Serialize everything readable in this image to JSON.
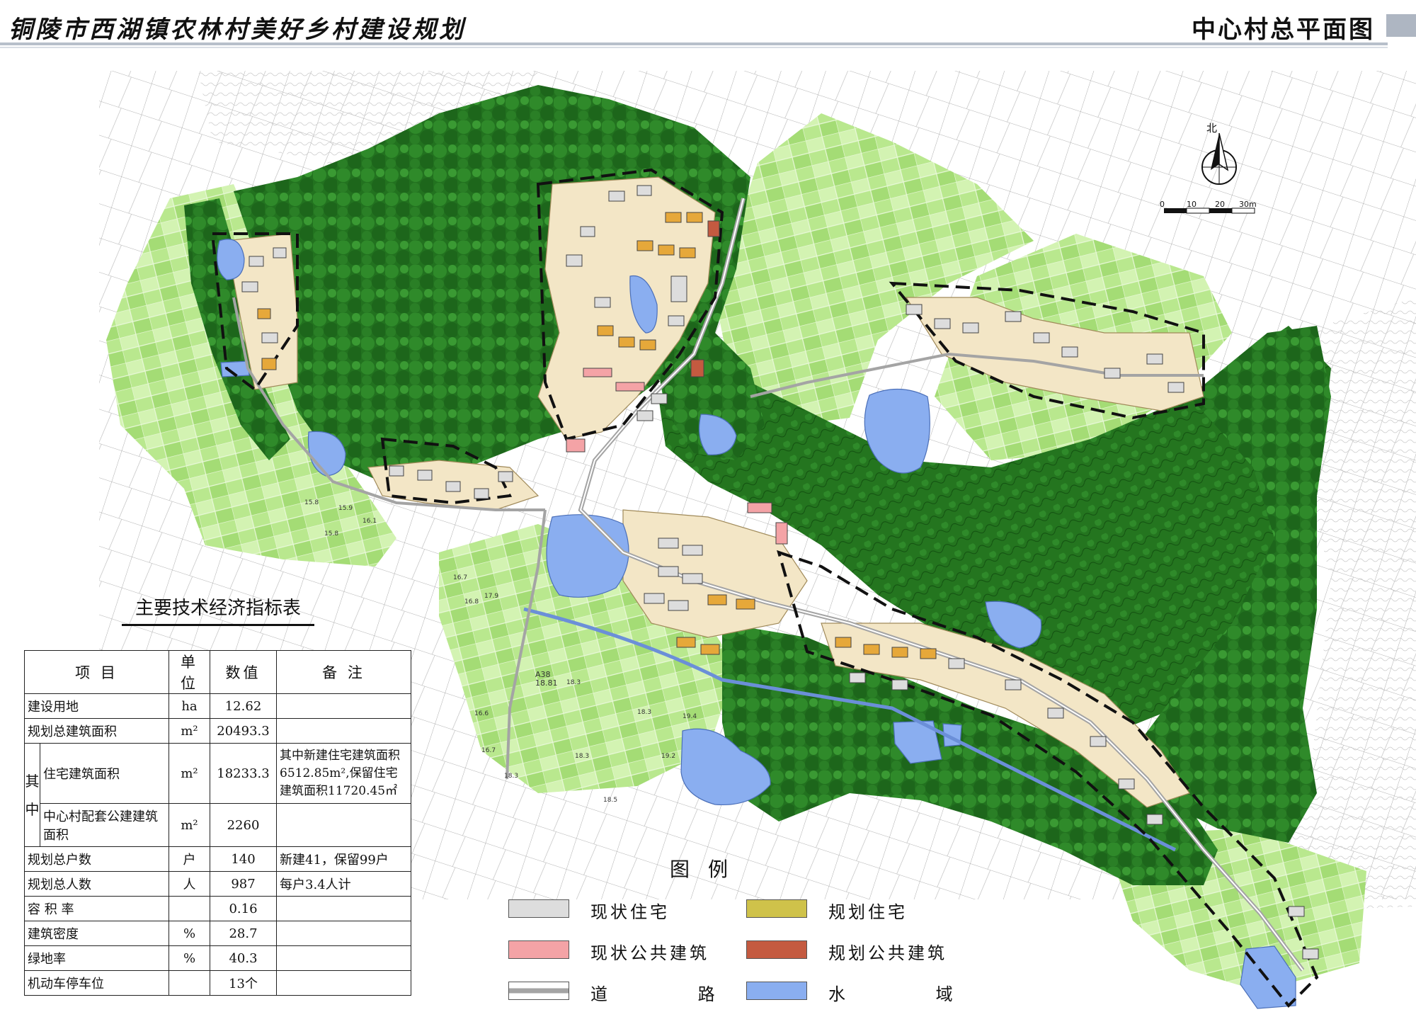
{
  "header": {
    "title": "铜陵市西湖镇农林村美好乡村建设规划",
    "right_title": "中心村总平面图"
  },
  "compass": {
    "north_label": "北"
  },
  "scale_bar": {
    "ticks": [
      "0",
      "10",
      "20",
      "30m"
    ]
  },
  "map_labels": {
    "spot_heights": [
      "15.8",
      "15.9",
      "16.1",
      "15.8",
      "16.7",
      "16.8",
      "17.9",
      "16.6",
      "18.3",
      "18.3",
      "19.4",
      "19.2",
      "18.3",
      "18.5",
      "16.7",
      "18.3"
    ],
    "road_code": "A38",
    "road_code_value": "18.81"
  },
  "tech_table": {
    "title": "主要技术经济指标表",
    "headers": [
      "项 目",
      "单位",
      "数值",
      "备 注"
    ],
    "group_label_top": "其",
    "group_label_bottom": "中",
    "rows": [
      {
        "item": "建设用地",
        "unit": "ha",
        "value": "12.62",
        "note": ""
      },
      {
        "item": "规划总建筑面积",
        "unit": "m²",
        "value": "20493.3",
        "note": ""
      },
      {
        "item": "住宅建筑面积",
        "unit": "m²",
        "value": "18233.3",
        "note": "其中新建住宅建筑面积6512.85m²,保留住宅建筑面积11720.45㎡"
      },
      {
        "item": "中心村配套公建建筑面积",
        "unit": "m²",
        "value": "2260",
        "note": ""
      },
      {
        "item": "规划总户数",
        "unit": "户",
        "value": "140",
        "note": "新建41，保留99户"
      },
      {
        "item": "规划总人数",
        "unit": "人",
        "value": "987",
        "note": "每户3.4人计"
      },
      {
        "item": "容 积 率",
        "unit": "",
        "value": "0.16",
        "note": ""
      },
      {
        "item": "建筑密度",
        "unit": "%",
        "value": "28.7",
        "note": ""
      },
      {
        "item": "绿地率",
        "unit": "%",
        "value": "40.3",
        "note": ""
      },
      {
        "item": "机动车停车位",
        "unit": "",
        "value": "13个",
        "note": ""
      }
    ]
  },
  "legend": {
    "title": "图例",
    "items": [
      {
        "label": "现状住宅",
        "color": "#dddddd",
        "kind": "fill"
      },
      {
        "label": "规划住宅",
        "color": "#cfc24a",
        "kind": "fill"
      },
      {
        "label": "现状公共建筑",
        "color": "#f4a3a6",
        "kind": "fill"
      },
      {
        "label": "规划公共建筑",
        "color": "#c45a40",
        "kind": "fill"
      },
      {
        "label": "道 路",
        "color": "#a4a4a4",
        "kind": "road"
      },
      {
        "label": "水 域",
        "color": "#8aaef0",
        "kind": "fill"
      }
    ]
  },
  "colors": {
    "forest_dark": "#1f6e1c",
    "forest_mid": "#2f8a2a",
    "field_light": "#c9f0a2",
    "field_mid": "#9ad86b",
    "village_ground": "#f3e6c6",
    "water": "#8aaef0",
    "existing_house": "#dddddd",
    "planned_house": "#e6a83a",
    "existing_public": "#f4a3a6",
    "planned_public": "#c45a40"
  }
}
